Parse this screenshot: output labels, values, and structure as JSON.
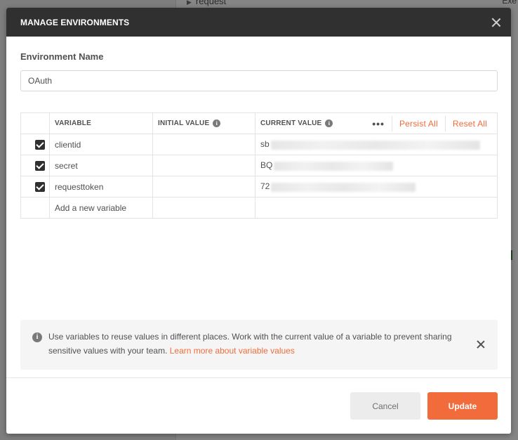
{
  "background": {
    "request_label": "request",
    "exe_label": "Exe"
  },
  "modal": {
    "title": "MANAGE ENVIRONMENTS",
    "env_name_label": "Environment Name",
    "env_name_value": "OAuth",
    "table": {
      "headers": {
        "variable": "VARIABLE",
        "initial_value": "INITIAL VALUE",
        "current_value": "CURRENT VALUE",
        "more": "•••",
        "persist_all": "Persist All",
        "reset_all": "Reset All"
      },
      "rows": [
        {
          "variable": "clientid",
          "initial_value": "",
          "current_value_prefix": "sb",
          "checked": true
        },
        {
          "variable": "secret",
          "initial_value": "",
          "current_value_prefix": "BQ",
          "checked": true
        },
        {
          "variable": "requesttoken",
          "initial_value": "",
          "current_value_prefix": "72",
          "checked": true
        }
      ],
      "new_variable_placeholder": "Add a new variable"
    },
    "info_banner": {
      "text": "Use variables to reuse values in different places. Work with the current value of a variable to prevent sharing sensitive values with your team.",
      "link": "Learn more about variable values"
    },
    "buttons": {
      "cancel": "Cancel",
      "update": "Update"
    }
  },
  "colors": {
    "accent": "#f26b3a",
    "header_bg": "#303030"
  },
  "icons": {
    "close": "close-icon",
    "info": "info-icon",
    "more": "more-horizontal-icon",
    "checkbox": "checkbox-checked-icon"
  }
}
